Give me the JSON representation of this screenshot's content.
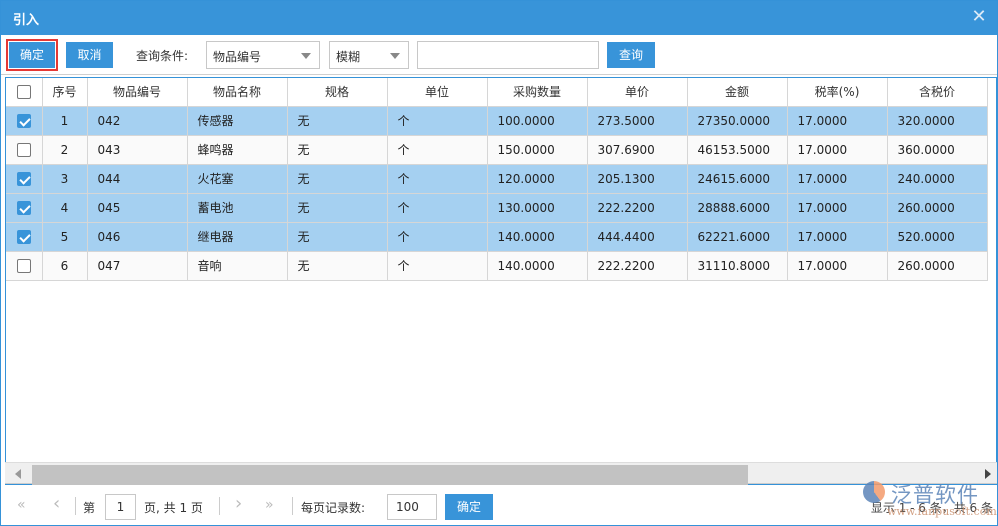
{
  "dialog": {
    "title": "引入",
    "close_icon": "close-icon"
  },
  "toolbar": {
    "confirm_label": "确定",
    "cancel_label": "取消",
    "query_condition_label": "查询条件:",
    "field_select_value": "物品编号",
    "match_select_value": "模糊",
    "search_input_value": "",
    "query_button_label": "查询"
  },
  "table": {
    "columns": [
      "",
      "序号",
      "物品编号",
      "物品名称",
      "规格",
      "单位",
      "采购数量",
      "单价",
      "金额",
      "税率(%)",
      "含税价"
    ],
    "rows": [
      {
        "checked": true,
        "seq": "1",
        "code": "042",
        "name": "传感器",
        "spec": "无",
        "unit": "个",
        "qty": "100.0000",
        "price": "273.5000",
        "amount": "27350.0000",
        "tax_rate": "17.0000",
        "tax_price": "320.0000"
      },
      {
        "checked": false,
        "seq": "2",
        "code": "043",
        "name": "蜂鸣器",
        "spec": "无",
        "unit": "个",
        "qty": "150.0000",
        "price": "307.6900",
        "amount": "46153.5000",
        "tax_rate": "17.0000",
        "tax_price": "360.0000"
      },
      {
        "checked": true,
        "seq": "3",
        "code": "044",
        "name": "火花塞",
        "spec": "无",
        "unit": "个",
        "qty": "120.0000",
        "price": "205.1300",
        "amount": "24615.6000",
        "tax_rate": "17.0000",
        "tax_price": "240.0000"
      },
      {
        "checked": true,
        "seq": "4",
        "code": "045",
        "name": "蓄电池",
        "spec": "无",
        "unit": "个",
        "qty": "130.0000",
        "price": "222.2200",
        "amount": "28888.6000",
        "tax_rate": "17.0000",
        "tax_price": "260.0000"
      },
      {
        "checked": true,
        "seq": "5",
        "code": "046",
        "name": "继电器",
        "spec": "无",
        "unit": "个",
        "qty": "140.0000",
        "price": "444.4400",
        "amount": "62221.6000",
        "tax_rate": "17.0000",
        "tax_price": "520.0000"
      },
      {
        "checked": false,
        "seq": "6",
        "code": "047",
        "name": "音响",
        "spec": "无",
        "unit": "个",
        "qty": "140.0000",
        "price": "222.2200",
        "amount": "31110.8000",
        "tax_rate": "17.0000",
        "tax_price": "260.0000"
      }
    ]
  },
  "pager": {
    "first_icon": "«",
    "prev_icon": "‹",
    "page_prefix": "第",
    "current_page": "1",
    "page_suffix": "页, 共 1 页",
    "next_icon": "›",
    "last_icon": "»",
    "page_size_label": "每页记录数:",
    "page_size_value": "100",
    "apply_label": "确定",
    "summary": "显示 1 - 6 条，共 6 条"
  },
  "watermark": {
    "brand": "泛普软件",
    "url": "www.fanpusoft.com"
  },
  "colors": {
    "primary": "#3894d9",
    "selected_row": "#a5d0f1",
    "highlight_border": "#e53935"
  }
}
